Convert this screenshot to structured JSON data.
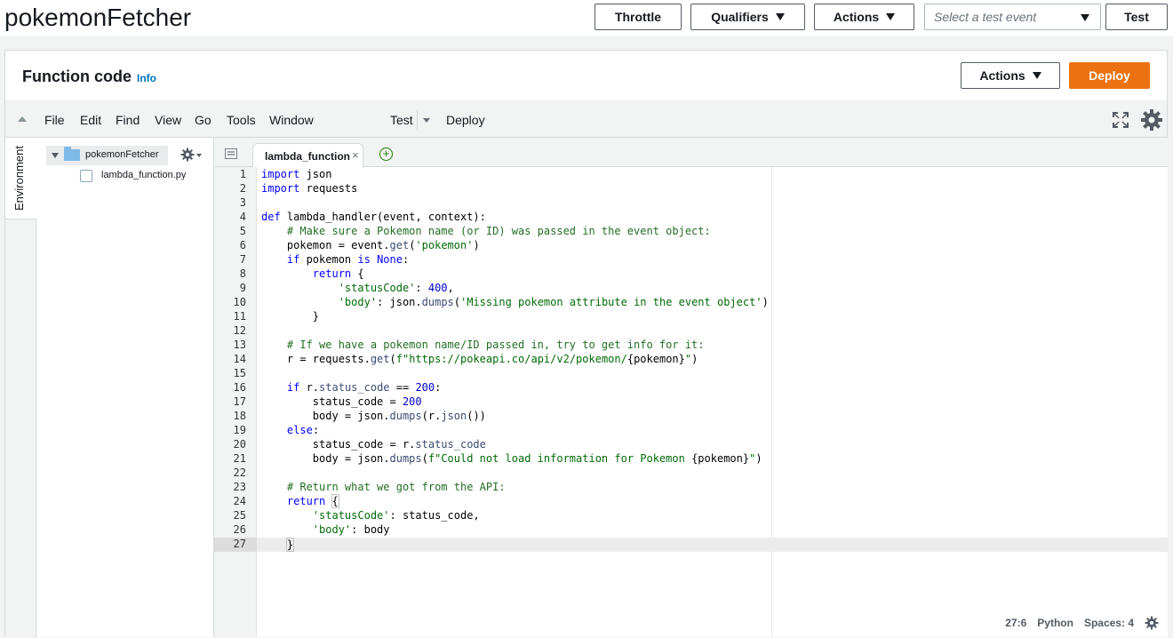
{
  "header": {
    "function_name": "pokemonFetcher",
    "throttle_label": "Throttle",
    "qualifiers_label": "Qualifiers",
    "actions_label": "Actions",
    "test_event_placeholder": "Select a test event",
    "test_label": "Test"
  },
  "panel": {
    "title": "Function code",
    "info_label": "Info",
    "actions_label": "Actions",
    "deploy_label": "Deploy"
  },
  "menubar": {
    "items": [
      "File",
      "Edit",
      "Find",
      "View",
      "Go",
      "Tools",
      "Window"
    ],
    "test_label": "Test",
    "deploy_label": "Deploy"
  },
  "sidebar": {
    "env_label": "Environment",
    "root_folder": "pokemonFetcher",
    "file": "lambda_function.py"
  },
  "editor": {
    "tab_label": "lambda_function",
    "active_line": 27
  },
  "statusbar": {
    "position": "27:6",
    "language": "Python",
    "spaces": "Spaces: 4"
  },
  "colors": {
    "deploy_orange": "#ec7211",
    "info_blue": "#0073bb",
    "keyword_blue": "#0000ff",
    "comment_green": "#236e24",
    "string_green": "#036a07"
  }
}
